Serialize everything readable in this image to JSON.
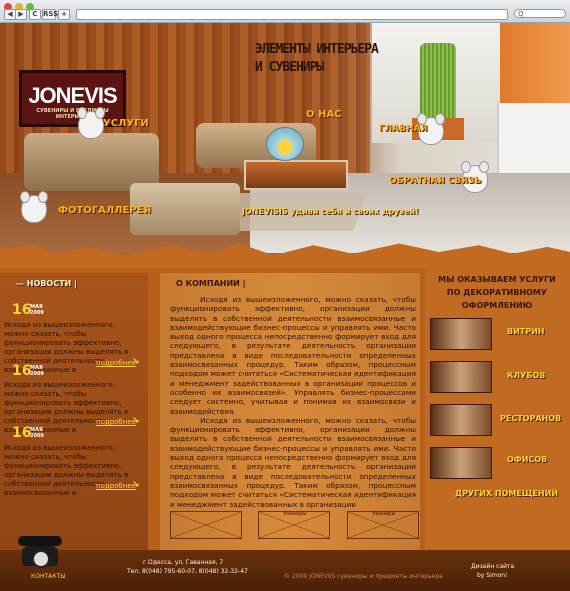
{
  "browser": {
    "nav_back": "◀",
    "nav_forward": "▶",
    "reload": "C",
    "rss": "RSS",
    "add": "+",
    "search_placeholder": "Q"
  },
  "brand": {
    "logo_title": "JONEVIS",
    "logo_subtitle": "СУВЕНИРЫ И ПРЕДМЕТЫ ИНТЕРЬЕРА",
    "tagline_line1": "ЭЛЕМЕНТЫ ИНТЕРЬЕРА",
    "tagline_line2": "И СУВЕНИРЫ",
    "slogan": "JONEVISIS удиви себя и своих друзей!"
  },
  "nav": {
    "services": "УСЛУГИ",
    "about": "О НАС",
    "home": "ГЛАВНАЯ",
    "feedback": "ОБРАТНАЯ СВЯЗЬ",
    "gallery": "ФОТОГАЛЛЕРЕЯ"
  },
  "news": {
    "heading": "НОВОСТИ",
    "items": [
      {
        "day": "16",
        "month": "МАЯ",
        "year": "2009",
        "text": "Исходя из вышеизложенного, можно сказать, чтобы функционировать эффективно, организации должны выделять в собственной деятельности взаимосвязанные и",
        "more": "подробнее"
      },
      {
        "day": "16",
        "month": "МАЯ",
        "year": "2009",
        "text": "Исходя из вышеизложенного, можно сказать, чтобы функционировать эффективно, организации должны выделять в собственной деятельности взаимосвязанные и",
        "more": "подробнее"
      },
      {
        "day": "16",
        "month": "МАЯ",
        "year": "2009",
        "text": "Исходя из вышеизложенного, можно сказать, чтобы функционировать эффективно, организации должны выделять в собственной деятельности взаимосвязанные и",
        "more": "подробнее"
      }
    ]
  },
  "about": {
    "heading": "О КОМПАНИИ",
    "p1": "Исходя из вышеизложенного, можно сказать, чтобы функционировать эффективно, организации должны выделять в собственной деятельности взаимосвязанные и взаимодействующие бизнес-процессы и управлять ими. Часто выход одного процесса непосредственно формирует вход для следующего, в результате деятельность организации представлена в виде последовательности определенных взаимосвязанных процедур. Таким образом, процессным подходом может считаться «Систематическая идентификация и менеджмент задействованных в организации процессов и особенно их взаимосвязей». Управлять бизнес-процессами следует системно, учитывая и понимая их взаимосвязи и взаимодействия.",
    "p2": "Исходя из вышеизложенного, можно сказать, чтобы функционировать эффективно, организации должны выделять в собственной деятельности взаимосвязанные и взаимодействующие бизнес-процессы и управлять ими. Часто выход одного процесса непосредственно формирует вход для следующего, в результате деятельность организации представлена в виде последовательности определенных взаимосвязанных процедур. Таким образом, процессным подходом может считаться «Систематическая идентификация и менеджмент задействованных в организации"
  },
  "banners": [
    "",
    "баннеры",
    "баннеры"
  ],
  "services": {
    "heading": "МЫ ОКАЗЫВАЕМ УСЛУГИ ПО ДЕКОРАТИВНОМУ ОФОРМЛЕНИЮ",
    "items": [
      "ВИТРИН",
      "КЛУБОВ",
      "РЕСТОРАНОВ",
      "ОФИСОВ"
    ],
    "other": "ДРУГИХ ПОМЕЩЕНИЙ"
  },
  "footer": {
    "contacts": "КОНТАКТЫ",
    "address": "г.Одесса, ул. Гаванная, 7",
    "phones": "Тел. 8(048) 795-60-07, 8(048) 32-32-47",
    "copyright": "©  2009  JONEVIIS сувениры и предметы интерьера",
    "design_line1": "Дизайн сайта",
    "design_line2": "by Simon!"
  },
  "colors": {
    "accent": "#ffd23a",
    "background": "#b8601a",
    "footer": "#4a2008"
  }
}
